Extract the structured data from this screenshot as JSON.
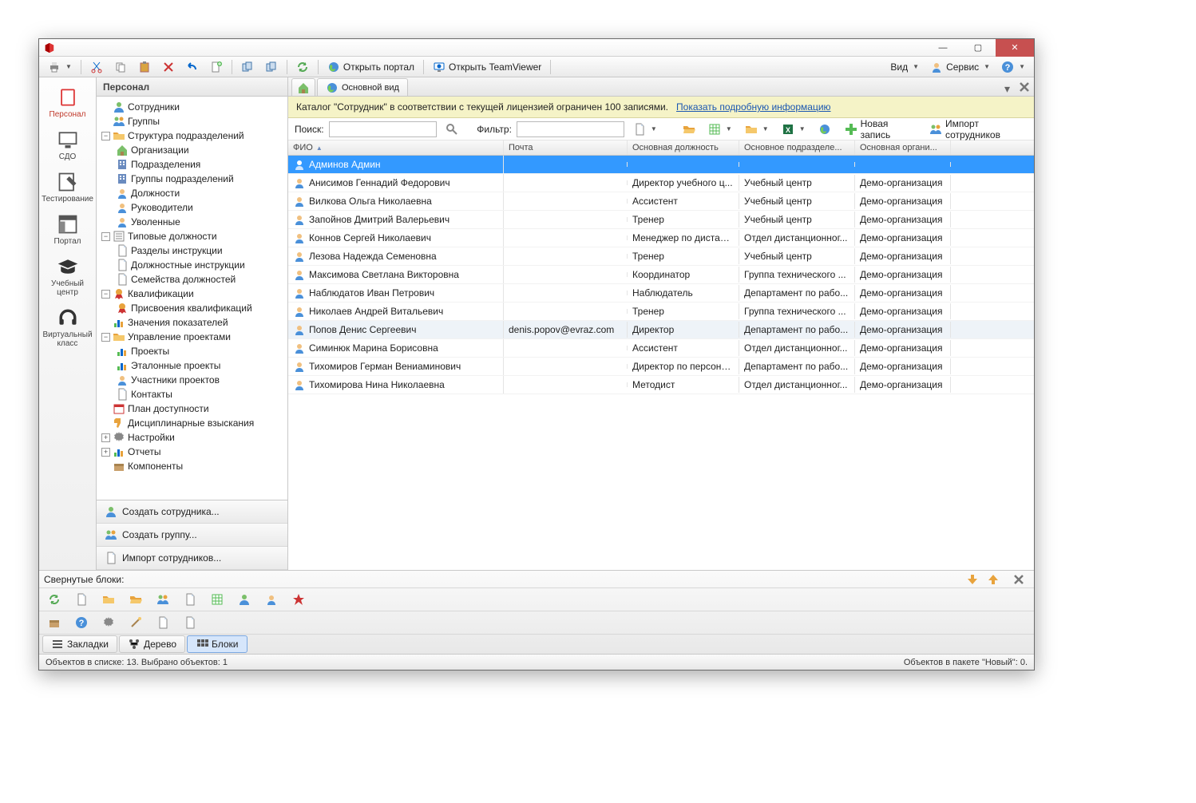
{
  "toolbar": {
    "open_portal": "Открыть портал",
    "open_teamviewer": "Открыть TeamViewer",
    "view": "Вид",
    "service": "Сервис"
  },
  "iconbar": [
    {
      "id": "personnel",
      "label": "Персонал"
    },
    {
      "id": "sdo",
      "label": "СДО"
    },
    {
      "id": "testing",
      "label": "Тестирование"
    },
    {
      "id": "portal",
      "label": "Портал"
    },
    {
      "id": "edu-center",
      "label": "Учебный центр"
    },
    {
      "id": "virtual-class",
      "label": "Виртуальный класс"
    }
  ],
  "nav": {
    "header": "Персонал",
    "items": {
      "employees": "Сотрудники",
      "groups": "Группы",
      "org_structure": "Структура подразделений",
      "organizations": "Организации",
      "subdivisions": "Подразделения",
      "subdivision_groups": "Группы подразделений",
      "positions": "Должности",
      "managers": "Руководители",
      "dismissed": "Уволенные",
      "typical_positions": "Типовые должности",
      "instruction_sections": "Разделы инструкции",
      "job_instructions": "Должностные инструкции",
      "position_families": "Семейства должностей",
      "qualifications": "Квалификации",
      "qualification_assignments": "Присвоения квалификаций",
      "indicator_values": "Значения показателей",
      "project_mgmt": "Управление проектами",
      "projects": "Проекты",
      "template_projects": "Эталонные проекты",
      "project_participants": "Участники проектов",
      "contacts": "Контакты",
      "availability_plan": "План доступности",
      "disciplinary": "Дисциплинарные взыскания",
      "settings": "Настройки",
      "reports": "Отчеты",
      "components": "Компоненты"
    },
    "actions": {
      "create_employee": "Создать сотрудника...",
      "create_group": "Создать группу...",
      "import_employees": "Импорт сотрудников..."
    }
  },
  "tabs": {
    "main_view": "Основной вид"
  },
  "info": {
    "text": "Каталог \"Сотрудник\" в соответствии с текущей лицензией ограничен 100 записями.",
    "link": "Показать подробную информацию"
  },
  "search": {
    "search_label": "Поиск:",
    "filter_label": "Фильтр:",
    "new_record": "Новая запись",
    "import_employees": "Импорт сотрудников"
  },
  "columns": {
    "fio": "ФИО",
    "mail": "Почта",
    "position": "Основная должность",
    "department": "Основное подразделе...",
    "organization": "Основная органи..."
  },
  "rows": [
    {
      "fio": "Админов Админ",
      "mail": "",
      "pos": "",
      "dep": "",
      "org": "",
      "sel": true
    },
    {
      "fio": "Анисимов Геннадий Федорович",
      "mail": "",
      "pos": "Директор учебного ц...",
      "dep": "Учебный центр",
      "org": "Демо-организация"
    },
    {
      "fio": "Вилкова Ольга Николаевна",
      "mail": "",
      "pos": "Ассистент",
      "dep": "Учебный центр",
      "org": "Демо-организация"
    },
    {
      "fio": "Запойнов Дмитрий Валерьевич",
      "mail": "",
      "pos": "Тренер",
      "dep": "Учебный центр",
      "org": "Демо-организация"
    },
    {
      "fio": "Коннов Сергей Николаевич",
      "mail": "",
      "pos": "Менеджер по дистанц...",
      "dep": "Отдел дистанционног...",
      "org": "Демо-организация"
    },
    {
      "fio": "Лезова Надежда Семеновна",
      "mail": "",
      "pos": "Тренер",
      "dep": "Учебный центр",
      "org": "Демо-организация"
    },
    {
      "fio": "Максимова Светлана Викторовна",
      "mail": "",
      "pos": "Координатор",
      "dep": "Группа технического ...",
      "org": "Демо-организация"
    },
    {
      "fio": "Наблюдатов Иван Петрович",
      "mail": "",
      "pos": "Наблюдатель",
      "dep": "Департамент по рабо...",
      "org": "Демо-организация"
    },
    {
      "fio": "Николаев Андрей Витальевич",
      "mail": "",
      "pos": "Тренер",
      "dep": "Группа технического ...",
      "org": "Демо-организация"
    },
    {
      "fio": "Попов Денис Сергеевич",
      "mail": "denis.popov@evraz.com",
      "pos": "Директор",
      "dep": "Департамент по рабо...",
      "org": "Демо-организация",
      "hov": true
    },
    {
      "fio": "Симинюк Марина Борисовна",
      "mail": "",
      "pos": "Ассистент",
      "dep": "Отдел дистанционног...",
      "org": "Демо-организация"
    },
    {
      "fio": "Тихомиров Герман Вениаминович",
      "mail": "",
      "pos": "Директор по персоналу",
      "dep": "Департамент по рабо...",
      "org": "Демо-организация"
    },
    {
      "fio": "Тихомирова Нина Николаевна",
      "mail": "",
      "pos": "Методист",
      "dep": "Отдел дистанционног...",
      "org": "Демо-организация"
    }
  ],
  "dock": {
    "header": "Свернутые блоки:",
    "tabs": {
      "bookmarks": "Закладки",
      "tree": "Дерево",
      "blocks": "Блоки"
    }
  },
  "status": {
    "left": "Объектов в списке: 13. Выбрано объектов: 1",
    "right": "Объектов в пакете \"Новый\": 0."
  }
}
